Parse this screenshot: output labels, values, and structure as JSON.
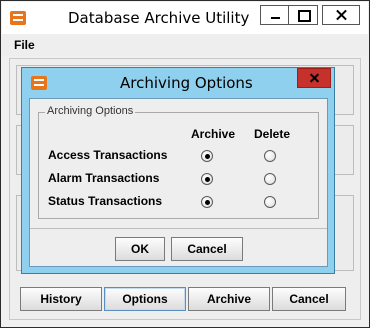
{
  "main_window": {
    "title": "Database Archive Utility",
    "menu": [
      "File"
    ],
    "buttons": {
      "history": "History",
      "options": "Options",
      "archive": "Archive",
      "cancel": "Cancel"
    }
  },
  "dialog": {
    "title": "Archiving Options",
    "group_title": "Archiving Options",
    "columns": [
      "Archive",
      "Delete"
    ],
    "rows": [
      {
        "label": "Access Transactions",
        "selected": "Archive"
      },
      {
        "label": "Alarm Transactions",
        "selected": "Archive"
      },
      {
        "label": "Status Transactions",
        "selected": "Archive"
      }
    ],
    "buttons": {
      "ok": "OK",
      "cancel": "Cancel"
    }
  },
  "colors": {
    "dialog_frame": "#8fd0ee",
    "dialog_close": "#c7312b",
    "app_icon": "#e8751a",
    "window_bg": "#f0f0f0"
  },
  "icons": {
    "app": "database-archive-app-icon",
    "minimize": "minimize-icon",
    "maximize": "maximize-icon",
    "close": "close-icon"
  }
}
